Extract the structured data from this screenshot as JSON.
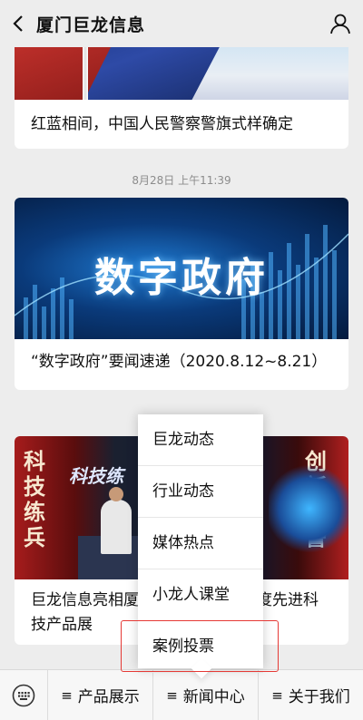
{
  "header": {
    "title": "厦门巨龙信息",
    "back_icon": "chevron-left-icon",
    "profile_icon": "user-icon"
  },
  "feed": {
    "articles": [
      {
        "title": "红蓝相间，中国人民警察警旗式样确定"
      },
      {
        "title": "“数字政府”要闻速递（2020.8.12~8.21）",
        "image_text": "数字政府"
      },
      {
        "title": "巨龙信息亮相厦...度先进科技产品展",
        "title_left": "巨龙信息亮相厦",
        "title_right": "度先进科",
        "title_line2": "技产品展",
        "image_left_text": "科技练兵",
        "image_right_text": "创新强警",
        "image_banner": "科技练"
      }
    ],
    "timestamp": "8月28日 上午11:39"
  },
  "popup_menu": {
    "items": [
      "巨龙动态",
      "行业动态",
      "媒体热点",
      "小龙人课堂",
      "案例投票"
    ],
    "highlight_color": "#e53935"
  },
  "bottom_menu": {
    "keyboard_icon": "keyboard-icon",
    "buttons": [
      {
        "label": "产品展示"
      },
      {
        "label": "新闻中心"
      },
      {
        "label": "关于我们"
      }
    ]
  }
}
